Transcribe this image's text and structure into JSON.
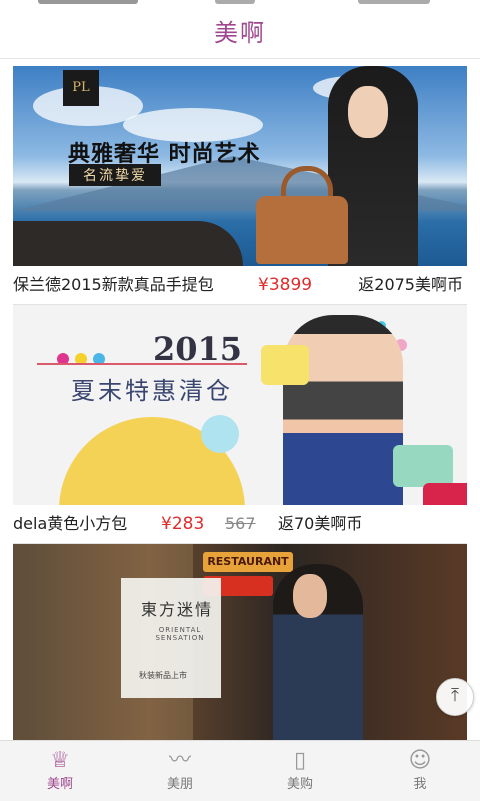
{
  "app": {
    "title": "美啊",
    "accent_color": "#a0488f"
  },
  "products": [
    {
      "banner": {
        "slogan": "典雅奢华  时尚艺术",
        "tag": "名流挚爱",
        "logo_text": "PL"
      },
      "name": "保兰德2015新款真品手提包",
      "price": "¥3899",
      "old_price": "",
      "cashback": "返2075美啊币"
    },
    {
      "banner": {
        "year": "2015",
        "headline": "夏末特惠清仓"
      },
      "name": "dela黄色小方包",
      "price": "¥283",
      "old_price": "567",
      "cashback": "返70美啊币"
    },
    {
      "banner": {
        "title": "東方迷情",
        "subtitle_en": "ORIENTAL SENSATION",
        "footer": "秋装新品上市",
        "neon_sign": "RESTAURANT"
      }
    }
  ],
  "back_to_top": {
    "icon": "arrow-up-icon",
    "glyph": "⤒"
  },
  "tabbar": {
    "tabs": [
      {
        "label": "美啊",
        "icon": "meia-logo-icon",
        "glyph": "♕",
        "active": true
      },
      {
        "label": "美朋",
        "icon": "swan-icon",
        "glyph": "〰",
        "active": false
      },
      {
        "label": "美购",
        "icon": "shopping-bag-icon",
        "glyph": "▯",
        "active": false
      },
      {
        "label": "我",
        "icon": "person-icon",
        "glyph": "☺",
        "active": false
      }
    ]
  }
}
